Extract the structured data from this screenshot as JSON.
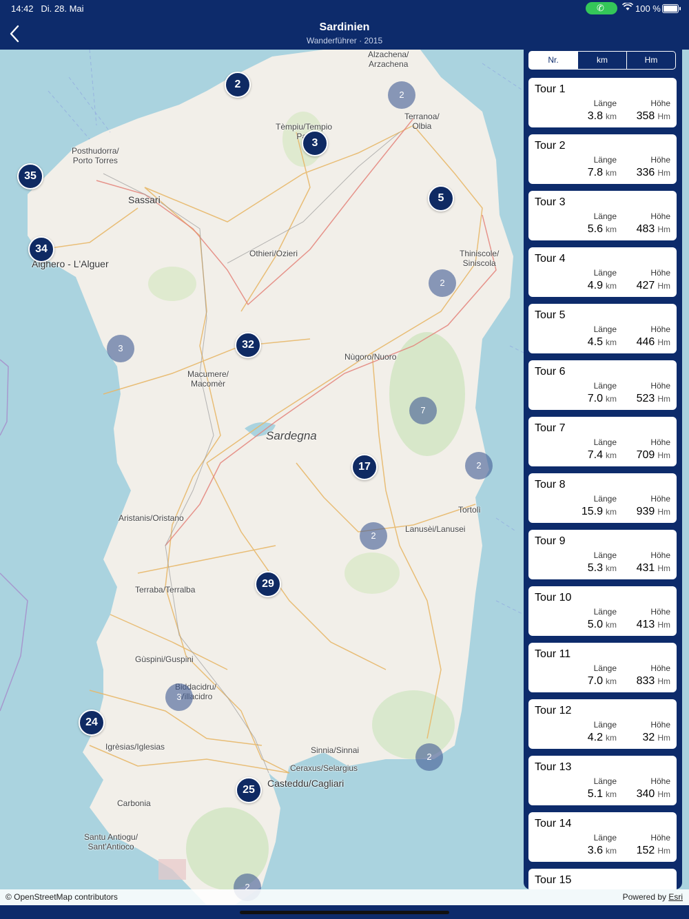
{
  "status": {
    "time": "14:42",
    "date": "Di. 28. Mai",
    "battery": "100 %",
    "call_icon": "phone-icon",
    "wifi_icon": "wifi-icon",
    "battery_level": 1.0
  },
  "nav": {
    "back_icon": "chevron-left-icon",
    "title": "Sardinien",
    "subtitle": "Wanderführer · 2015"
  },
  "map": {
    "region_label": "Sardegna",
    "places": [
      "Alzachena/\nArzachena",
      "Terranoa/\nOlbia",
      "Tèmpiu/Tempio\nPau",
      "Posthudorra/\nPorto Torres",
      "Sassari",
      "Alghero - L'Alguer",
      "Othieri/Ozieri",
      "Thiniscole/\nSiniscola",
      "Nùgoro/Nuoro",
      "Macumere/\nMacomèr",
      "Tortolì",
      "Aristanis/Oristano",
      "Lanusèi/Lanusei",
      "Terraba/Terralba",
      "Gùspini/Guspini",
      "Biddacidru/\nVillacidro",
      "Igrèsias/Iglesias",
      "Sinnia/Sinnai",
      "Ceraxus/Selargius",
      "Casteddu/Cagliari",
      "Carbonia",
      "Santu Antiogu/\nSant'Antioco"
    ],
    "markers": [
      "2",
      "3",
      "5",
      "35",
      "34",
      "32",
      "17",
      "29",
      "24",
      "25"
    ],
    "clusters": [
      "2",
      "2",
      "3",
      "7",
      "2",
      "2",
      "3",
      "2",
      "2"
    ],
    "attribution_left": "© OpenStreetMap contributors",
    "attribution_powered": "Powered by ",
    "attribution_brand": "Esri"
  },
  "sort": {
    "options": [
      "Nr.",
      "km",
      "Hm"
    ],
    "selected": "Nr."
  },
  "list": {
    "length_label": "Länge",
    "height_label": "Höhe",
    "length_unit": "km",
    "height_unit": "Hm",
    "tours": [
      {
        "name": "Tour 1",
        "km": "3.8",
        "hm": "358"
      },
      {
        "name": "Tour 2",
        "km": "7.8",
        "hm": "336"
      },
      {
        "name": "Tour 3",
        "km": "5.6",
        "hm": "483"
      },
      {
        "name": "Tour 4",
        "km": "4.9",
        "hm": "427"
      },
      {
        "name": "Tour 5",
        "km": "4.5",
        "hm": "446"
      },
      {
        "name": "Tour 6",
        "km": "7.0",
        "hm": "523"
      },
      {
        "name": "Tour 7",
        "km": "7.4",
        "hm": "709"
      },
      {
        "name": "Tour 8",
        "km": "15.9",
        "hm": "939"
      },
      {
        "name": "Tour 9",
        "km": "5.3",
        "hm": "431"
      },
      {
        "name": "Tour 10",
        "km": "5.0",
        "hm": "413"
      },
      {
        "name": "Tour 11",
        "km": "7.0",
        "hm": "833"
      },
      {
        "name": "Tour 12",
        "km": "4.2",
        "hm": "32"
      },
      {
        "name": "Tour 13",
        "km": "5.1",
        "hm": "340"
      },
      {
        "name": "Tour 14",
        "km": "3.6",
        "hm": "152"
      },
      {
        "name": "Tour 15",
        "km": "",
        "hm": ""
      }
    ]
  }
}
